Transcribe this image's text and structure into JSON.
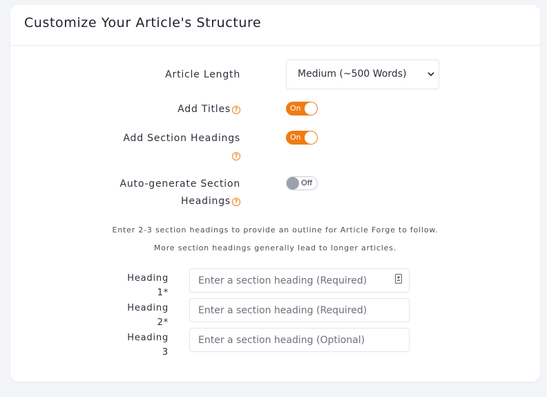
{
  "header": {
    "title": "Customize Your Article's Structure"
  },
  "settings": {
    "article_length": {
      "label": "Article Length",
      "selected": "Medium (~500 Words)"
    },
    "add_titles": {
      "label": "Add Titles",
      "state": "On"
    },
    "add_section_headings": {
      "label": "Add Section Headings",
      "state": "On"
    },
    "auto_generate": {
      "label_line1": "Auto-generate Section",
      "label_line2": "Headings",
      "state": "Off"
    },
    "help_icon": "?"
  },
  "info": {
    "line1": "Enter 2-3 section headings to provide an outline for Article Forge to follow.",
    "line2": "More section headings generally lead to longer articles."
  },
  "headings": [
    {
      "label_line1": "Heading",
      "label_line2": "1*",
      "placeholder": "Enter a section heading (Required)"
    },
    {
      "label_line1": "Heading",
      "label_line2": "2*",
      "placeholder": "Enter a section heading (Required)"
    },
    {
      "label_line1": "Heading",
      "label_line2": "3",
      "placeholder": "Enter a section heading (Optional)"
    }
  ],
  "colors": {
    "accent": "#f07c12",
    "toggle_off_knob": "#9ba1ab"
  },
  "icons": {
    "select": "chevron-down-icon",
    "help": "help-circle-icon",
    "field": "autofill-contact-icon"
  }
}
